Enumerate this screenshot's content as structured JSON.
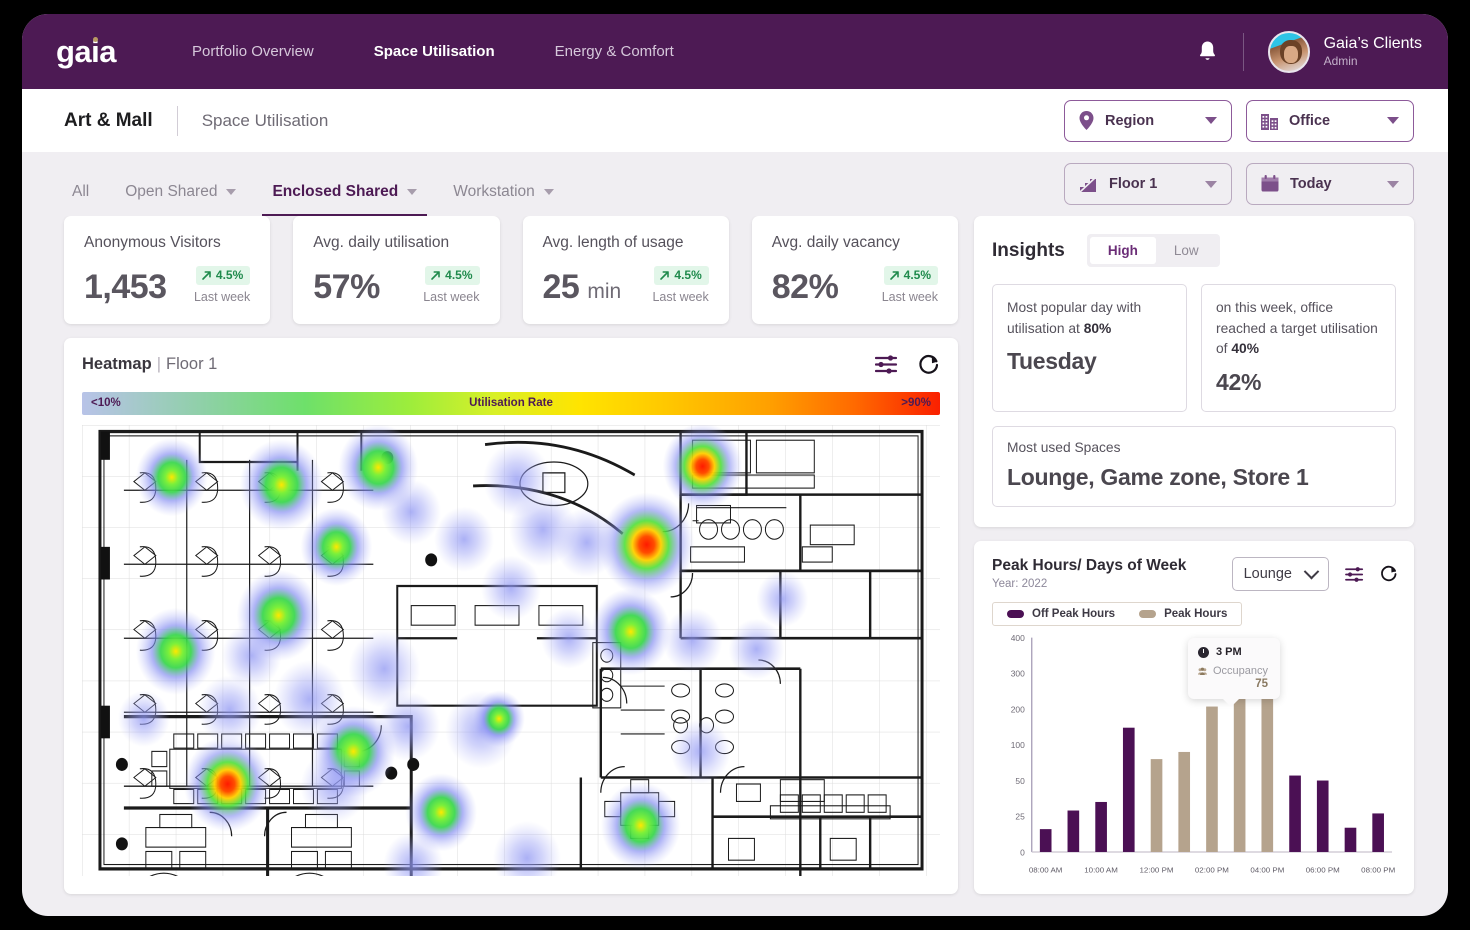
{
  "topnav": {
    "logo": "gaia",
    "links": [
      {
        "label": "Portfolio Overview",
        "active": false
      },
      {
        "label": "Space Utilisation",
        "active": true
      },
      {
        "label": "Energy & Comfort",
        "active": false
      }
    ],
    "bell_icon": "bell-icon",
    "user": {
      "name": "Gaia’s Clients",
      "role": "Admin"
    }
  },
  "breadcrumb": {
    "main": "Art & Mall",
    "sub": "Space Utilisation",
    "region_filter": "Region",
    "office_filter": "Office"
  },
  "filters": {
    "tabs": [
      {
        "label": "All",
        "caret": false,
        "active": false
      },
      {
        "label": "Open Shared",
        "caret": true,
        "active": false
      },
      {
        "label": "Enclosed Shared",
        "caret": true,
        "active": true
      },
      {
        "label": "Workstation",
        "caret": true,
        "active": false
      }
    ],
    "floor": "Floor 1",
    "date": "Today"
  },
  "kpis": [
    {
      "title": "Anonymous Visitors",
      "value": "1,453",
      "unit": "",
      "delta": "4.5%",
      "period": "Last week"
    },
    {
      "title": "Avg. daily utilisation",
      "value": "57%",
      "unit": "",
      "delta": "4.5%",
      "period": "Last week"
    },
    {
      "title": "Avg. length of usage",
      "value": "25",
      "unit": "min",
      "delta": "4.5%",
      "period": "Last week"
    },
    {
      "title": "Avg. daily vacancy",
      "value": "82%",
      "unit": "",
      "delta": "4.5%",
      "period": "Last week"
    }
  ],
  "heatmap": {
    "title": "Heatmap",
    "separator": "|",
    "floor": "Floor 1",
    "legend_low": "<10%",
    "legend_mid": "Utilisation Rate",
    "legend_high": ">90%"
  },
  "insights": {
    "title": "Insights",
    "toggle": [
      {
        "label": "High",
        "on": true
      },
      {
        "label": "Low",
        "on": false
      }
    ],
    "cards": [
      {
        "text_a": "Most popular day with",
        "text_b": "utilisation at ",
        "bold": "80%",
        "value": "Tuesday"
      },
      {
        "text_a": "on this week, office reached",
        "text_b": "a target utilisation of ",
        "bold": "40%",
        "value": "42%"
      }
    ],
    "most_used_label": "Most used Spaces",
    "most_used_value": "Lounge, Game zone, Store 1"
  },
  "peak": {
    "title": "Peak Hours/ Days of Week",
    "year": "Year: 2022",
    "space_select": "Lounge",
    "legend": [
      {
        "label": "Off Peak Hours",
        "color": "#4b1054"
      },
      {
        "label": "Peak Hours",
        "color": "#b5a38d"
      }
    ],
    "tooltip": {
      "time": "3 PM",
      "metric": "Occupancy",
      "value": "75"
    }
  },
  "chart_data": {
    "type": "bar",
    "title": "Peak Hours/ Days of Week",
    "subtitle": "Year: 2022",
    "xlabel": "",
    "ylabel": "",
    "grid": false,
    "legend_position": "top-left",
    "yticks": [
      0,
      25,
      50,
      100,
      200,
      300,
      400
    ],
    "ylim": [
      0,
      400
    ],
    "y_scale": "nonlinear",
    "categories": [
      "08:00 AM",
      "09:00 AM",
      "10:00 AM",
      "11:00 AM",
      "12:00 PM",
      "01:00 PM",
      "02:00 PM",
      "03:00 PM",
      "04:00 PM",
      "05:00 PM",
      "06:00 PM",
      "07:00 PM",
      "08:00 PM"
    ],
    "xtick_labels": [
      "08:00 AM",
      "10:00 AM",
      "12:00 PM",
      "02:00 PM",
      "04:00 PM",
      "06:00 PM",
      "08:00 PM"
    ],
    "values": [
      16,
      29,
      35,
      148,
      80,
      90,
      207,
      262,
      245,
      57,
      50,
      17,
      27
    ],
    "bar_types": [
      "off",
      "off",
      "off",
      "off",
      "peak",
      "peak",
      "peak",
      "peak",
      "peak",
      "off",
      "off",
      "off",
      "off"
    ],
    "series": [
      {
        "name": "Off Peak Hours",
        "color": "#4b1054"
      },
      {
        "name": "Peak Hours",
        "color": "#b5a38d"
      }
    ],
    "annotation": {
      "at": "03:00 PM",
      "time": "3 PM",
      "metric": "Occupancy",
      "value": 75
    }
  },
  "colors": {
    "brand_purple": "#4d1a54",
    "accent_purple": "#6b2d77",
    "peak_tan": "#b5a38d",
    "offpeak_purple": "#4b1054",
    "positive_green": "#1f8a4c",
    "page_bg": "#f0eef2"
  }
}
